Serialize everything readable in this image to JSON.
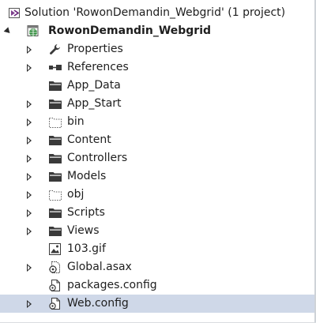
{
  "solution": {
    "label": "Solution 'RowonDemandin_Webgrid' (1 project)"
  },
  "project": {
    "label": "RowonDemandin_Webgrid"
  },
  "items": [
    {
      "label": "Properties",
      "icon": "wrench-icon",
      "expandable": true
    },
    {
      "label": "References",
      "icon": "references-icon",
      "expandable": true
    },
    {
      "label": "App_Data",
      "icon": "folder-icon",
      "expandable": false
    },
    {
      "label": "App_Start",
      "icon": "folder-icon",
      "expandable": true
    },
    {
      "label": "bin",
      "icon": "dashed-folder-icon",
      "expandable": true
    },
    {
      "label": "Content",
      "icon": "folder-icon",
      "expandable": true
    },
    {
      "label": "Controllers",
      "icon": "folder-icon",
      "expandable": true
    },
    {
      "label": "Models",
      "icon": "folder-icon",
      "expandable": true
    },
    {
      "label": "obj",
      "icon": "dashed-folder-icon",
      "expandable": true
    },
    {
      "label": "Scripts",
      "icon": "folder-icon",
      "expandable": true
    },
    {
      "label": "Views",
      "icon": "folder-icon",
      "expandable": true
    },
    {
      "label": "103.gif",
      "icon": "image-file-icon",
      "expandable": false
    },
    {
      "label": "Global.asax",
      "icon": "asax-file-icon",
      "expandable": true
    },
    {
      "label": "packages.config",
      "icon": "config-file-icon",
      "expandable": false
    },
    {
      "label": "Web.config",
      "icon": "config-file-icon",
      "expandable": true,
      "selected": true
    }
  ],
  "colors": {
    "selection": "#cfd8e8",
    "folder": "#3a3a3a",
    "project_globe": "#2e8b3a"
  }
}
